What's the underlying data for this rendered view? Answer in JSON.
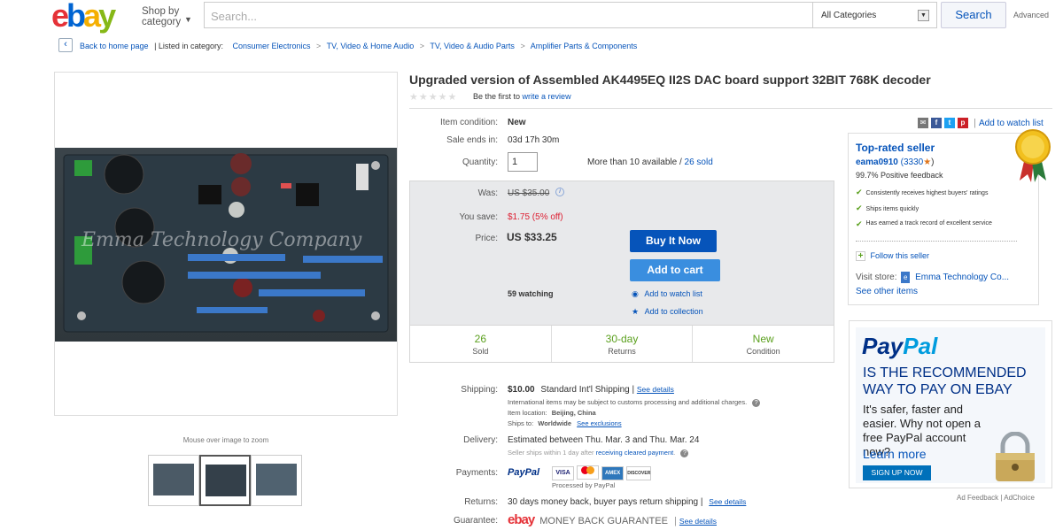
{
  "header": {
    "logo_letters": [
      "e",
      "b",
      "a",
      "y"
    ],
    "logo_colors": [
      "#e53238",
      "#0064d2",
      "#f5af02",
      "#86b817"
    ],
    "shop_by": "Shop by",
    "shop_by_2": "category",
    "search_placeholder": "Search...",
    "category": "All Categories",
    "search_button": "Search",
    "advanced": "Advanced"
  },
  "breadcrumb": {
    "back": "Back to home page",
    "listed": "| Listed in category:",
    "items": [
      "Consumer Electronics",
      "TV, Video & Home Audio",
      "TV, Video & Audio Parts",
      "Amplifier Parts & Components"
    ],
    "separator": ">"
  },
  "gallery": {
    "watermark": "Emma Technology Company",
    "hint": "Mouse over image to zoom"
  },
  "item": {
    "title": "Upgraded version of Assembled AK4495EQ II2S DAC board support 32BIT 768K decoder",
    "stars": "★★★★★",
    "be_first": "Be the first to",
    "write_review": "write a review",
    "condition_label": "Item condition:",
    "condition": "New",
    "ends_label": "Sale ends in:",
    "ends": "03d 17h 30m",
    "qty_label": "Quantity:",
    "qty": "1",
    "available": "More than 10 available",
    "slash": "/",
    "sold_link": "26 sold"
  },
  "price": {
    "was_label": "Was:",
    "was": "US $35.00",
    "save_label": "You save:",
    "save": "$1.75 (5% off)",
    "price_label": "Price:",
    "price": "US $33.25",
    "buy_now": "Buy It Now",
    "add_cart": "Add to cart",
    "watching": "59 watching",
    "watch_list": "Add to watch list",
    "collection": "Add to collection",
    "stats": [
      {
        "num": "26",
        "sub": "Sold"
      },
      {
        "num": "30-day",
        "sub": "Returns"
      },
      {
        "num": "New",
        "sub": "Condition"
      }
    ]
  },
  "shipping": {
    "label": "Shipping:",
    "cost": "$10.00",
    "method": "Standard Int'l Shipping |",
    "see": "See details",
    "note": "International items may be subject to customs processing and additional charges.",
    "loc_label": "Item location:",
    "loc": "Beijing, China",
    "to_label": "Ships to:",
    "to": "Worldwide",
    "exclusions": "See exclusions"
  },
  "delivery": {
    "label": "Delivery:",
    "text": "Estimated between Thu. Mar. 3 and Thu. Mar. 24",
    "note1": "Seller ships within 1 day after",
    "note_link": "receiving cleared payment",
    "note2": "."
  },
  "payments": {
    "label": "Payments:",
    "paypal": "PayPal",
    "cards": [
      "VISA",
      "MC",
      "AMEX",
      "DISCOVER"
    ],
    "processed": "Processed by PayPal"
  },
  "returns": {
    "label": "Returns:",
    "text": "30 days money back, buyer pays return shipping |",
    "see": "See details"
  },
  "guarantee": {
    "label": "Guarantee:",
    "logo": "ebay",
    "text": "MONEY BACK GUARANTEE",
    "sep": "|",
    "see": "See details"
  },
  "share": {
    "watch": "Add to watch list"
  },
  "seller": {
    "heading": "Top-rated seller",
    "name": "eama0910",
    "score": "(3330",
    "score_end": ")",
    "feedback": "99.7% Positive feedback",
    "points": [
      "Consistently receives highest buyers' ratings",
      "Ships items quickly",
      "Has earned a track record of excellent service"
    ],
    "follow": "Follow this seller",
    "visit": "Visit store:",
    "store": "Emma Technology Co...",
    "other": "See other items"
  },
  "ad": {
    "brand1": "Pay",
    "brand2": "Pal",
    "headline": "IS THE RECOMMENDED WAY TO PAY ON EBAY",
    "body": "It's safer, faster and easier. Why not open a free PayPal account now?",
    "learn": "Learn more",
    "signup": "SIGN UP NOW",
    "feedback": "Ad Feedback",
    "adchoice": "| AdChoice"
  }
}
